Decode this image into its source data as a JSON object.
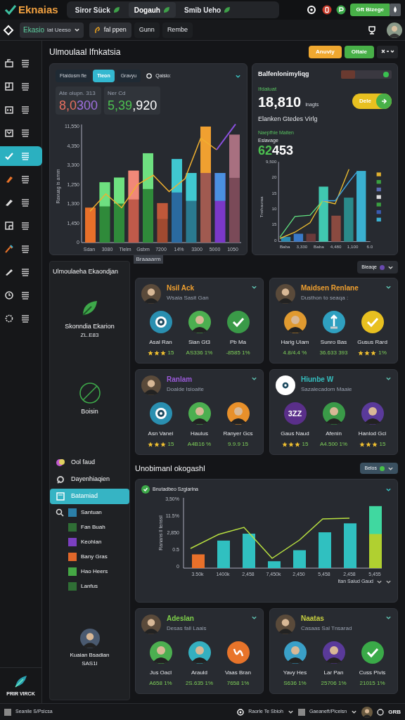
{
  "top_bar": {
    "logo": "Eknaias",
    "tabs": [
      {
        "label": "Siror Sück",
        "selected": false
      },
      {
        "label": "Dogauh",
        "selected": true
      },
      {
        "label": "Smib Ueho",
        "selected": false
      }
    ],
    "action_button": "Gft Bizege"
  },
  "toolbar": {
    "workspace": "Ekasio",
    "workspace_sub": "lat Ueeso",
    "buttons": [
      {
        "label": "fal ppen",
        "selected": true
      },
      {
        "label": "Gunn",
        "selected": false
      },
      {
        "label": "Rembe",
        "selected": false
      }
    ]
  },
  "sidebar": {
    "items": [
      {
        "selected": false
      },
      {
        "selected": false
      },
      {
        "selected": false
      },
      {
        "selected": false
      },
      {
        "selected": true
      },
      {
        "selected": false
      },
      {
        "selected": false
      },
      {
        "selected": false
      },
      {
        "selected": false
      },
      {
        "selected": false
      },
      {
        "selected": false
      },
      {
        "selected": false
      }
    ],
    "footer_label": "PRIR VIRCK"
  },
  "overview": {
    "title": "Ulmoulaal Ifnkatsia",
    "buttons": [
      {
        "label": "Anuviy",
        "kind": "warning"
      },
      {
        "label": "Oltaie",
        "kind": "success"
      }
    ],
    "main_panel": {
      "tabs": [
        {
          "label": "Ftaidosm fie",
          "selected": false
        },
        {
          "label": "Tieon",
          "selected": true
        },
        {
          "label": "Gravyu",
          "selected": false
        }
      ],
      "filter": "Qaisio:",
      "stats": [
        {
          "label": "Ate olupn. 313",
          "value_a": "8,0",
          "value_b": "300"
        },
        {
          "label": "Ner Cd",
          "value_a": "5,39",
          "value_b": ",920"
        }
      ],
      "y_ticks": [
        "11,550",
        "4,350",
        "3,300",
        "1,250",
        "1,300",
        "1,450",
        "0"
      ],
      "x_labels": [
        "Sdan",
        "3080",
        "Tlelm",
        "Gsbm",
        "7200",
        "14%",
        "3300",
        "5000",
        "1050"
      ],
      "axis_label": "Ravuag is arnm",
      "x_caption": "Braaaarm"
    },
    "side_panel": {
      "title": "Balfenlonimyliqg",
      "toggle_on": true,
      "metric_label": "Ifdaluat",
      "metric": "18,810",
      "metric_unit": "Inagts",
      "pill": "Dele",
      "subtitle": "Elanken Gtedes Virlg",
      "series_label": "Naepfhie Maiten",
      "series_sub": "Esiavage",
      "series_value_a": "62",
      "series_value_b": "453",
      "y_ticks": [
        "9,500",
        "20",
        "15",
        "10",
        "15",
        "0"
      ],
      "x_labels": [
        "Baba",
        "3,330",
        "Baba",
        "4,480",
        "1,100",
        "6.0"
      ],
      "axis_label": "Tnshauraa"
    }
  },
  "profile_panel": {
    "title": "Ulmoulaeha Ekaondjan",
    "name": "Skonndia Ekarion",
    "code": "ZL.E83",
    "empty_label": "Boisin",
    "menu": [
      {
        "label": "Ool faud",
        "selected": false
      },
      {
        "label": "Dayenhiaqien",
        "selected": false
      },
      {
        "label": "Batamiad",
        "selected": true
      }
    ],
    "legend": [
      {
        "label": "Santuan",
        "color": "#2b7fa8"
      },
      {
        "label": "Fan Buah",
        "color": "#2f6e35"
      },
      {
        "label": "Keohlan",
        "color": "#7b3fc0"
      },
      {
        "label": "Bany Gras",
        "color": "#e0672a"
      },
      {
        "label": "Hao Heers",
        "color": "#45a845"
      },
      {
        "label": "Lanfus",
        "color": "#2f6e35"
      }
    ],
    "user_name": "Kuaian Bsadian",
    "user_code": "SAS1I"
  },
  "team_filter": "Bieaqe",
  "cards": [
    {
      "title": "Nsil Ack",
      "subtitle": "Wsaia Sasit Gan",
      "color": "#f0a030",
      "kind": "person",
      "people": [
        {
          "name": "Asal Ran",
          "kind": "target",
          "color": "#2a8fb0",
          "stars": 3,
          "score": "15"
        },
        {
          "name": "Sian Gt3",
          "kind": "person",
          "color": "#4caf50",
          "score": "AS336 1%"
        },
        {
          "name": "Pb Ma",
          "kind": "check",
          "color": "#3a9a48",
          "score": "-8585 1%"
        }
      ]
    },
    {
      "title": "Maidsen Renlane",
      "subtitle": "Dusthon to seaqa :",
      "color": "#f0a030",
      "kind": "person",
      "people": [
        {
          "name": "Harig Ulam",
          "kind": "person",
          "color": "#e09a30",
          "score": "4.8/4.4 %"
        },
        {
          "name": "Sunro Bas",
          "kind": "pin",
          "color": "#2fa0c0",
          "score": "36.633 393"
        },
        {
          "name": "Gusus Rard",
          "kind": "check",
          "color": "#e8c020",
          "stars": 3,
          "score": "1%"
        }
      ]
    },
    {
      "title": "Ranlam",
      "subtitle": "Doalde Isioaite",
      "color": "#9a5ad8",
      "kind": "person",
      "people": [
        {
          "name": "Asn Vanei",
          "kind": "target",
          "color": "#2a8fb0",
          "stars": 3,
          "score": "15"
        },
        {
          "name": "Haulus",
          "kind": "person",
          "color": "#4caf50",
          "score": "A4B16 %"
        },
        {
          "name": "Ranyer Gcs",
          "kind": "person",
          "color": "#e8902a",
          "score": "9.9.9 15"
        }
      ]
    },
    {
      "title": "Hiunbe W",
      "subtitle": "Sazalecadom Maaie",
      "color": "#35c0c0",
      "kind": "target",
      "people": [
        {
          "name": "Gaus Naud",
          "kind": "text",
          "label": "3ZZ",
          "color": "#5a2f8a",
          "stars": 3,
          "score": "15"
        },
        {
          "name": "Afenin",
          "kind": "person",
          "color": "#3a9a48",
          "score": "A4.500 1%"
        },
        {
          "name": "Hanlod Gci",
          "kind": "person",
          "color": "#5a3a9a",
          "stars": 3,
          "score": "15"
        }
      ]
    }
  ],
  "usage": {
    "title": "Unobimanl okogashl",
    "filter": "Belos",
    "chart_title": "Bnutadbeo Szglarlna",
    "y_ticks": [
      "3,50%",
      "11.5%",
      "2,850",
      "0.5",
      "0"
    ],
    "x_labels": [
      "3.50k",
      "1400k",
      "2,458",
      "7,450k",
      "2,450",
      "5,458",
      "2,458",
      "5,455"
    ],
    "axis_label": "Ranans ll tenssl",
    "footer": "Itan Saiud Gaud"
  },
  "cards_bottom": [
    {
      "title": "Adeslan",
      "subtitle": "Desas fall Laais",
      "color": "#7ed04a",
      "kind": "person",
      "people": [
        {
          "name": "Jus Oacl",
          "kind": "person",
          "color": "#4caf50",
          "score": "A658 1%"
        },
        {
          "name": "Arauld",
          "kind": "person",
          "color": "#35b0c0",
          "score": "2S.635 1%"
        },
        {
          "name": "Vaas Bran",
          "kind": "glyph",
          "color": "#e8742a",
          "score": "7658 1%"
        }
      ]
    },
    {
      "title": "Naatas",
      "subtitle": "Casaas Sal Tnsarad",
      "color": "#c8d040",
      "kind": "person",
      "people": [
        {
          "name": "Yavy Hes",
          "kind": "person",
          "color": "#3aa0c8",
          "score": "S636 1%"
        },
        {
          "name": "Lar Pan",
          "kind": "person",
          "color": "#5a3a9a",
          "score": "25706 1%"
        },
        {
          "name": "Cuss Pivis",
          "kind": "check",
          "color": "#3aaa48",
          "score": "21015 1%"
        }
      ]
    }
  ],
  "status_bar": {
    "left": "Seanile S/Psicsa",
    "center": "Raorle Te Sbioh",
    "right": "Gaeaneft/Piceisn",
    "badge": "GRB"
  }
}
